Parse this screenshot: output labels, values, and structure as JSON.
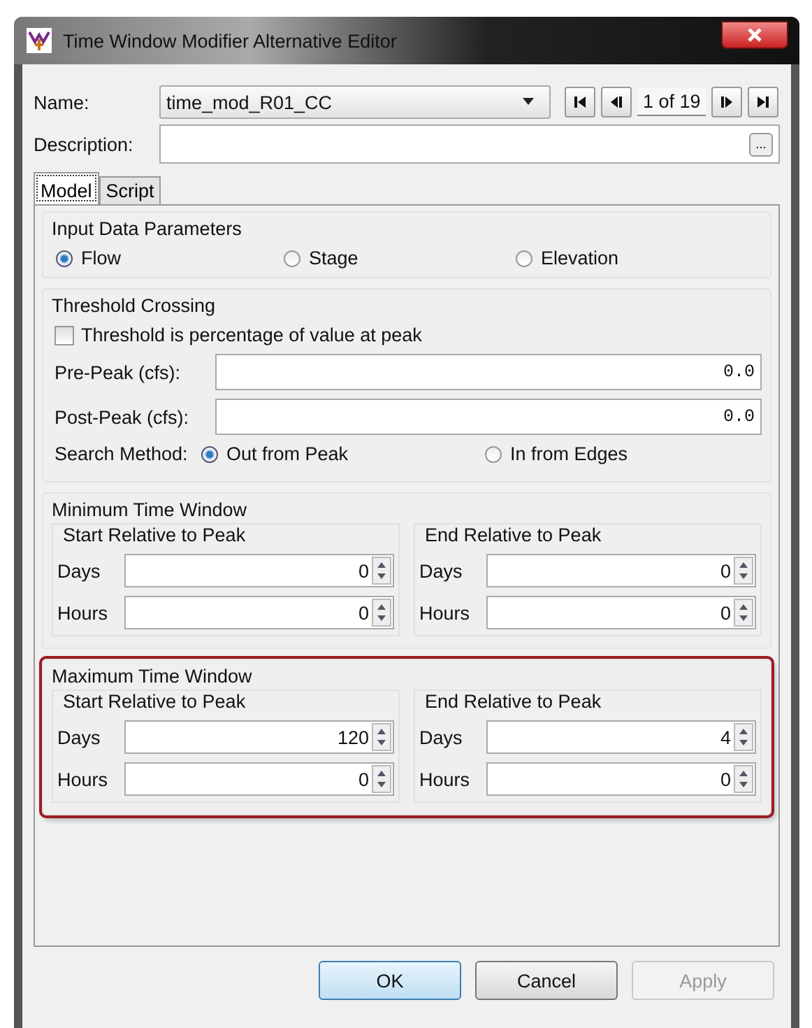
{
  "window": {
    "title": "Time Window Modifier Alternative Editor"
  },
  "name": {
    "label": "Name:",
    "value": "time_mod_R01_CC"
  },
  "navigator": {
    "position": "1 of 19"
  },
  "description": {
    "label": "Description:",
    "button": "..."
  },
  "tabs": [
    {
      "label": "Model",
      "selected": true
    },
    {
      "label": "Script",
      "selected": false
    }
  ],
  "input_data": {
    "title": "Input Data Parameters",
    "options": [
      {
        "label": "Flow",
        "selected": true
      },
      {
        "label": "Stage",
        "selected": false
      },
      {
        "label": "Elevation",
        "selected": false
      }
    ]
  },
  "threshold": {
    "title": "Threshold Crossing",
    "checkbox": {
      "label": "Threshold is percentage of value at peak",
      "checked": false
    },
    "fields": [
      {
        "label": "Pre-Peak (cfs):",
        "value": "0.0"
      },
      {
        "label": "Post-Peak (cfs):",
        "value": "0.0"
      }
    ],
    "search_method": {
      "label": "Search Method:",
      "options": [
        {
          "label": "Out from Peak",
          "selected": true
        },
        {
          "label": "In from Edges",
          "selected": false
        }
      ]
    }
  },
  "time_windows": [
    {
      "title": "Minimum Time Window",
      "highlighted": false,
      "groups": [
        {
          "title": "Start Relative to Peak",
          "fields": [
            {
              "label": "Days",
              "value": "0"
            },
            {
              "label": "Hours",
              "value": "0"
            }
          ]
        },
        {
          "title": "End Relative to Peak",
          "fields": [
            {
              "label": "Days",
              "value": "0"
            },
            {
              "label": "Hours",
              "value": "0"
            }
          ]
        }
      ]
    },
    {
      "title": "Maximum Time Window",
      "highlighted": true,
      "groups": [
        {
          "title": "Start Relative to Peak",
          "fields": [
            {
              "label": "Days",
              "value": "120"
            },
            {
              "label": "Hours",
              "value": "0"
            }
          ]
        },
        {
          "title": "End Relative to Peak",
          "fields": [
            {
              "label": "Days",
              "value": "4"
            },
            {
              "label": "Hours",
              "value": "0"
            }
          ]
        }
      ]
    }
  ],
  "buttons": [
    {
      "label": "OK",
      "disabled": false,
      "default": true
    },
    {
      "label": "Cancel",
      "disabled": false,
      "default": false
    },
    {
      "label": "Apply",
      "disabled": true,
      "default": false
    }
  ]
}
